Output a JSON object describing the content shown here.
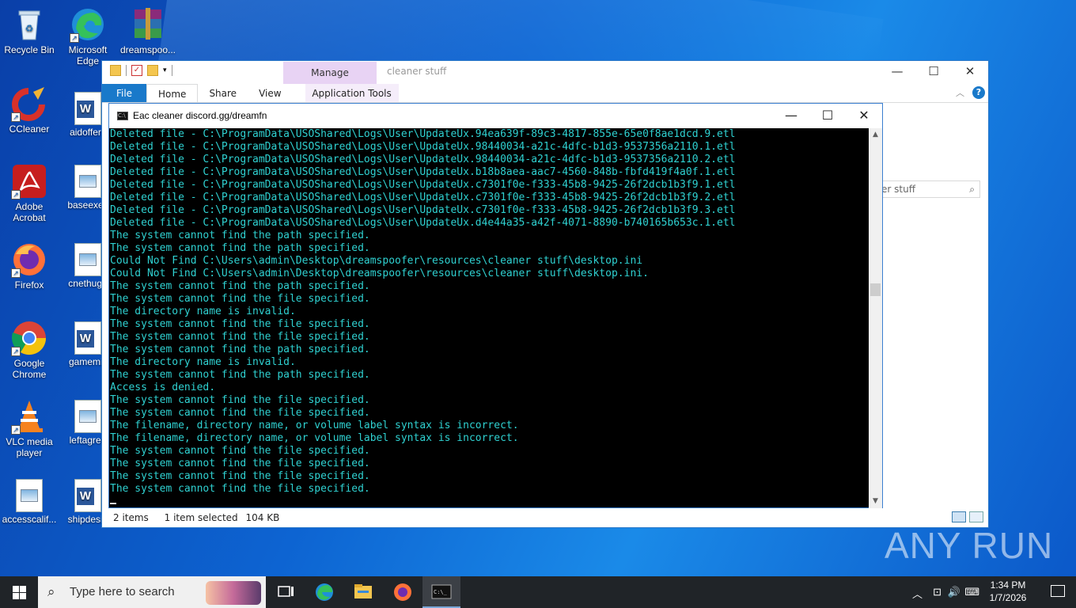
{
  "desktop": {
    "icons": [
      {
        "label": "Recycle Bin"
      },
      {
        "label": "Microsoft Edge"
      },
      {
        "label": "dreamspoo..."
      },
      {
        "label": "CCleaner"
      },
      {
        "label": "aidoffers"
      },
      {
        "label": "Adobe Acrobat"
      },
      {
        "label": "baseexec"
      },
      {
        "label": "Firefox"
      },
      {
        "label": "cnethuge"
      },
      {
        "label": "Google Chrome"
      },
      {
        "label": "gamemill"
      },
      {
        "label": "VLC media player"
      },
      {
        "label": "leftagree"
      },
      {
        "label": "accesscalif..."
      },
      {
        "label": "shipdesig"
      }
    ]
  },
  "explorer": {
    "title": "cleaner stuff",
    "manage_tab": "Manage",
    "tabs": [
      "File",
      "Home",
      "Share",
      "View",
      "Application Tools"
    ],
    "search_placeholder": "er stuff",
    "status": {
      "items": "2 items",
      "selected": "1 item selected",
      "size": "104 KB"
    }
  },
  "console": {
    "title": "Eac cleaner discord.gg/dreamfn",
    "lines": [
      "Deleted file - C:\\ProgramData\\USOShared\\Logs\\User\\UpdateUx.94ea639f-89c3-4817-855e-65e0f8ae1dcd.9.etl",
      "Deleted file - C:\\ProgramData\\USOShared\\Logs\\User\\UpdateUx.98440034-a21c-4dfc-b1d3-9537356a2110.1.etl",
      "Deleted file - C:\\ProgramData\\USOShared\\Logs\\User\\UpdateUx.98440034-a21c-4dfc-b1d3-9537356a2110.2.etl",
      "Deleted file - C:\\ProgramData\\USOShared\\Logs\\User\\UpdateUx.b18b8aea-aac7-4560-848b-fbfd419f4a0f.1.etl",
      "Deleted file - C:\\ProgramData\\USOShared\\Logs\\User\\UpdateUx.c7301f0e-f333-45b8-9425-26f2dcb1b3f9.1.etl",
      "Deleted file - C:\\ProgramData\\USOShared\\Logs\\User\\UpdateUx.c7301f0e-f333-45b8-9425-26f2dcb1b3f9.2.etl",
      "Deleted file - C:\\ProgramData\\USOShared\\Logs\\User\\UpdateUx.c7301f0e-f333-45b8-9425-26f2dcb1b3f9.3.etl",
      "Deleted file - C:\\ProgramData\\USOShared\\Logs\\User\\UpdateUx.d4e44a35-a42f-4071-8890-b740165b653c.1.etl",
      "The system cannot find the path specified.",
      "The system cannot find the path specified.",
      "Could Not Find C:\\Users\\admin\\Desktop\\dreamspoofer\\resources\\cleaner stuff\\desktop.ini",
      "Could Not Find C:\\Users\\admin\\Desktop\\dreamspoofer\\resources\\cleaner stuff\\desktop.ini.",
      "The system cannot find the path specified.",
      "The system cannot find the file specified.",
      "The directory name is invalid.",
      "The system cannot find the file specified.",
      "The system cannot find the file specified.",
      "The system cannot find the path specified.",
      "The directory name is invalid.",
      "The system cannot find the path specified.",
      "Access is denied.",
      "The system cannot find the file specified.",
      "The system cannot find the file specified.",
      "The filename, directory name, or volume label syntax is incorrect.",
      "The filename, directory name, or volume label syntax is incorrect.",
      "The system cannot find the file specified.",
      "The system cannot find the file specified.",
      "The system cannot find the file specified.",
      "The system cannot find the file specified."
    ],
    "text_color": "#2fd1d1"
  },
  "taskbar": {
    "search_placeholder": "Type here to search",
    "time": "1:34 PM",
    "date": "1/7/2026",
    "pinned": [
      "task-view-icon",
      "edge-icon",
      "file-explorer-icon",
      "firefox-icon",
      "cmd-icon"
    ]
  },
  "watermark": "ANY RUN"
}
